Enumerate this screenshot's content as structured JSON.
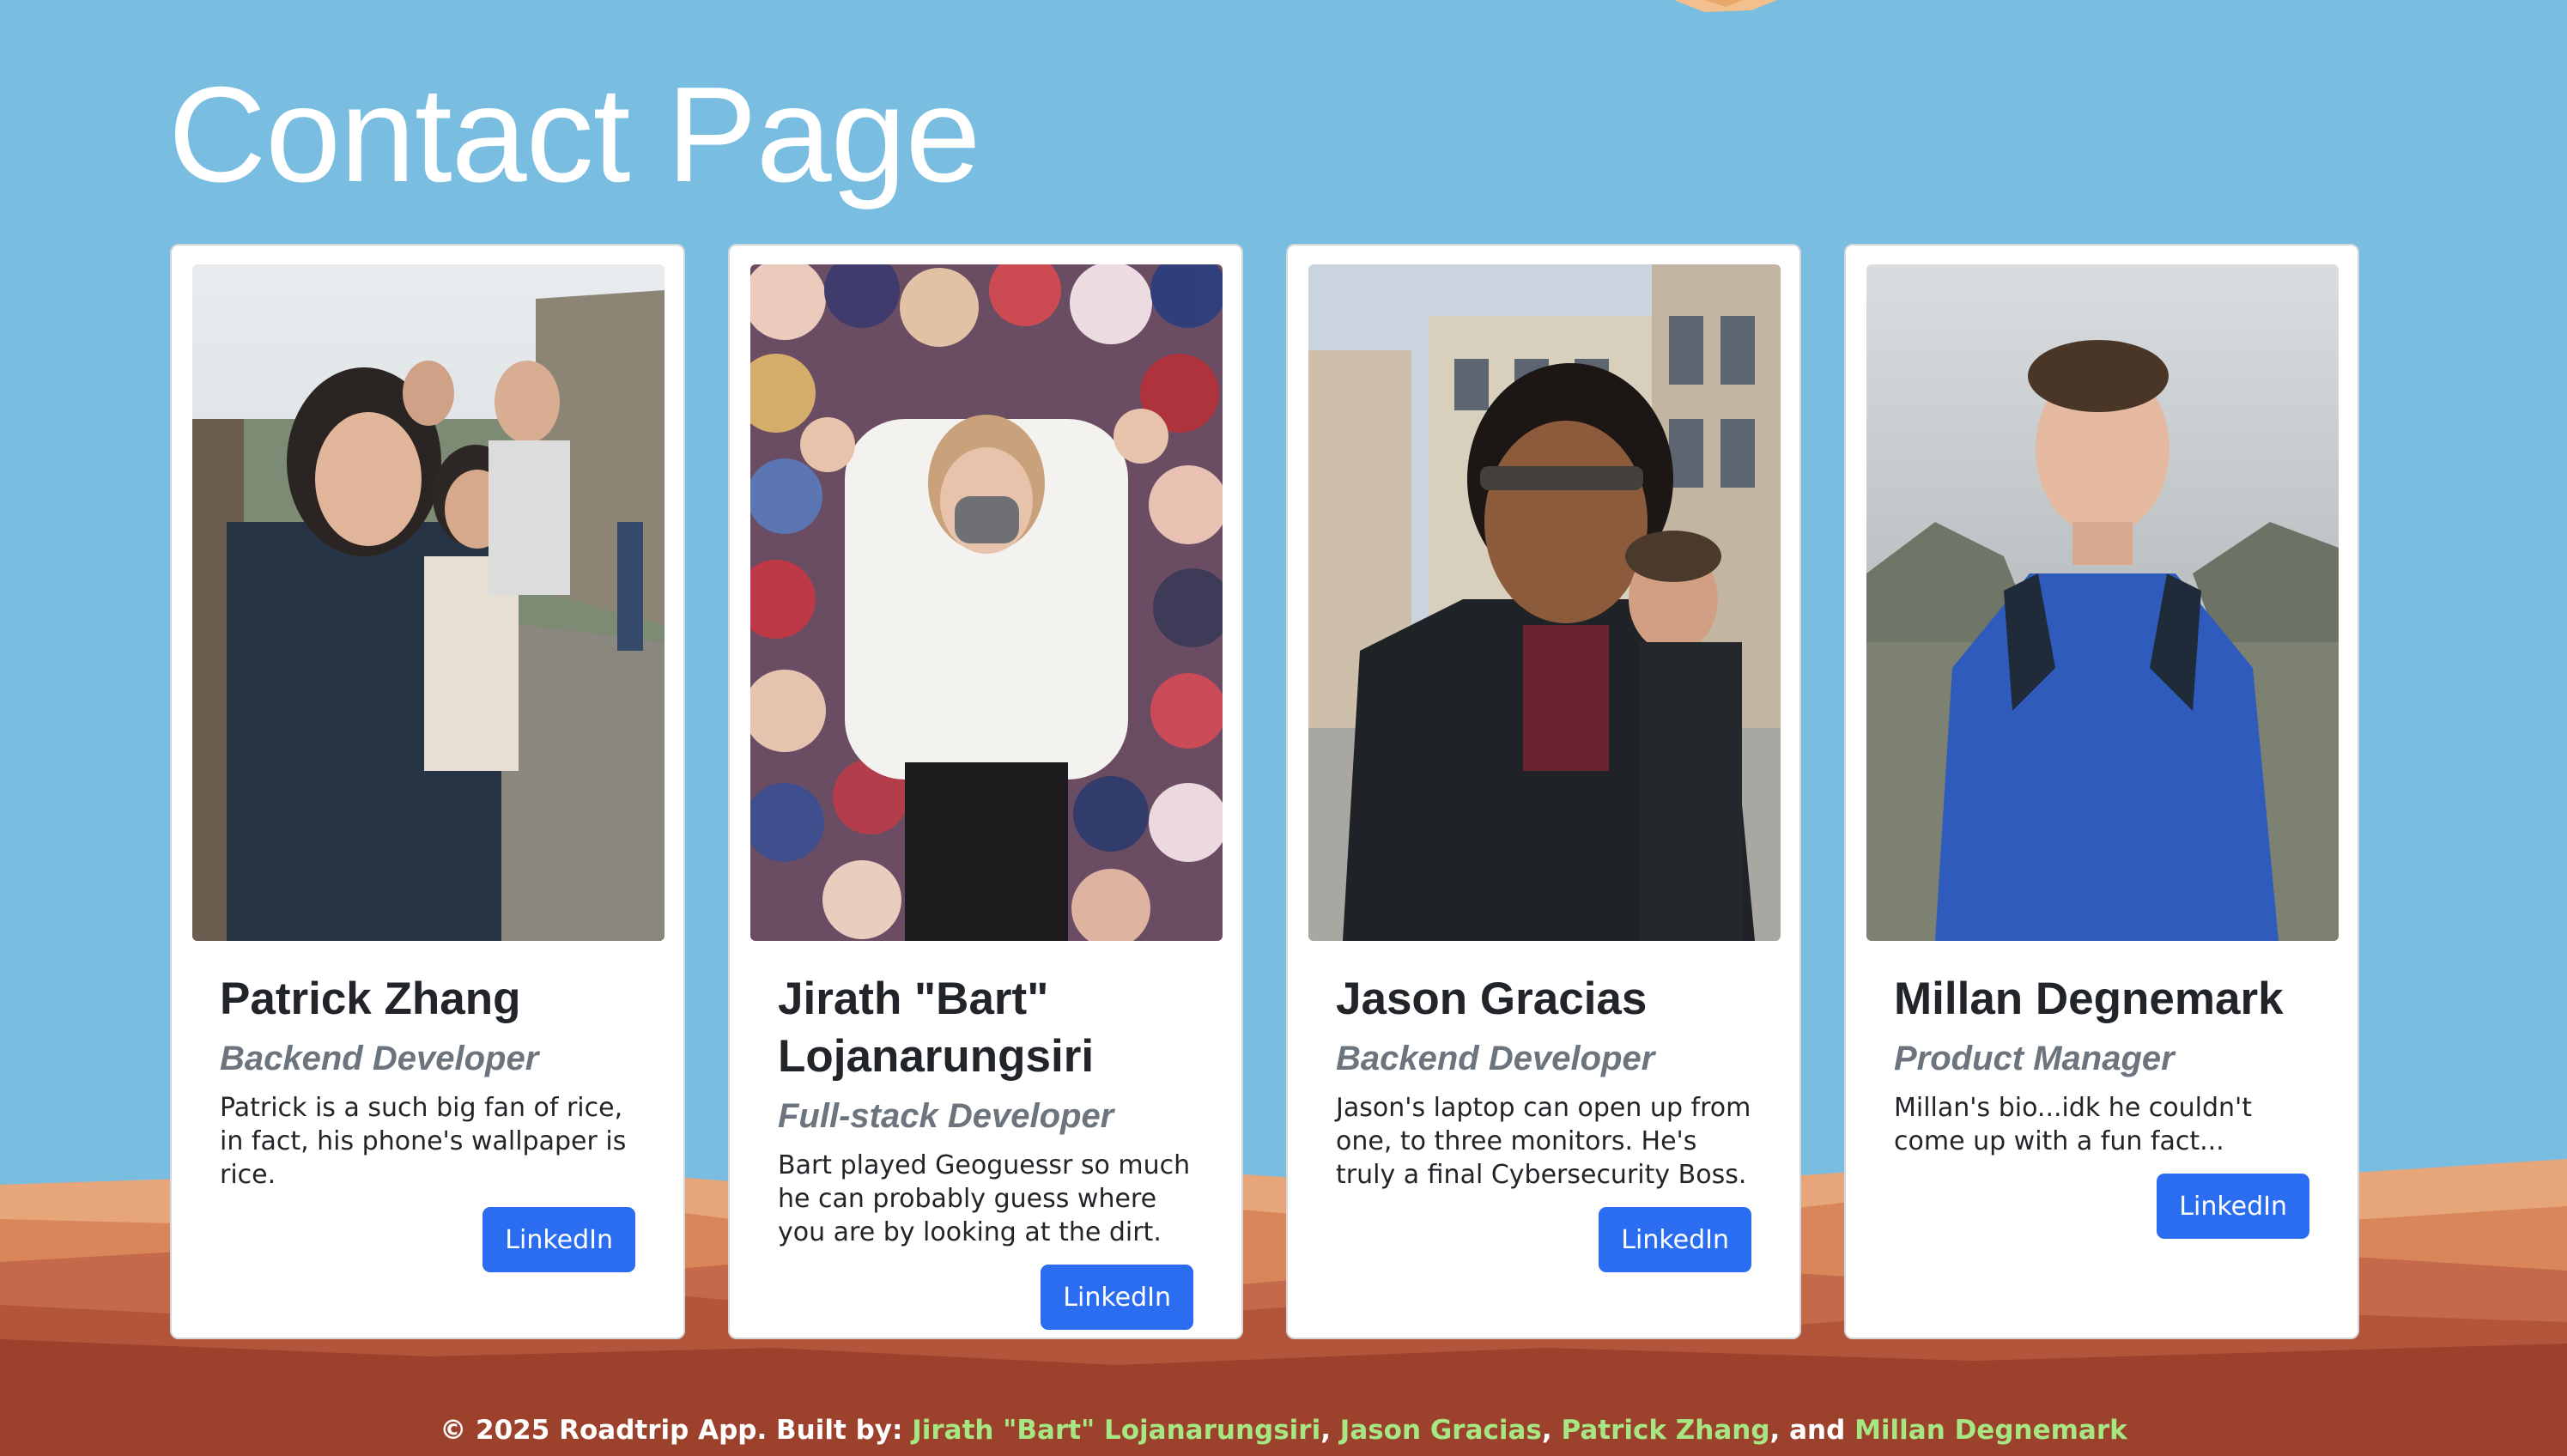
{
  "page": {
    "title": "Contact Page"
  },
  "team": [
    {
      "name": "Patrick Zhang",
      "role": "Backend Developer",
      "bio": "Patrick is a such big fan of rice, in fact, his phone's wallpaper is rice.",
      "link_label": "LinkedIn"
    },
    {
      "name": "Jirath \"Bart\" Lojanarungsiri",
      "role": "Full-stack Developer",
      "bio": "Bart played Geoguessr so much he can probably guess where you are by looking at the dirt.",
      "link_label": "LinkedIn"
    },
    {
      "name": "Jason Gracias",
      "role": "Backend Developer",
      "bio": "Jason's laptop can open up from one, to three monitors. He's truly a final Cybersecurity Boss.",
      "link_label": "LinkedIn"
    },
    {
      "name": "Millan Degnemark",
      "role": "Product Manager",
      "bio": "Millan's bio...idk he couldn't come up with a fun fact...",
      "link_label": "LinkedIn"
    }
  ],
  "footer": {
    "prefix": "© 2025 Roadtrip App. Built by: ",
    "authors": [
      "Jirath \"Bart\" Lojanarungsiri",
      "Jason Gracias",
      "Patrick Zhang",
      "Millan Degnemark"
    ],
    "sep1": ", ",
    "sep2": ", ",
    "sep3": ", and "
  },
  "colors": {
    "sky": "#79bde1",
    "button": "#2a6df0",
    "footer_author": "#a6e783",
    "ground_dark": "#9c412c"
  }
}
